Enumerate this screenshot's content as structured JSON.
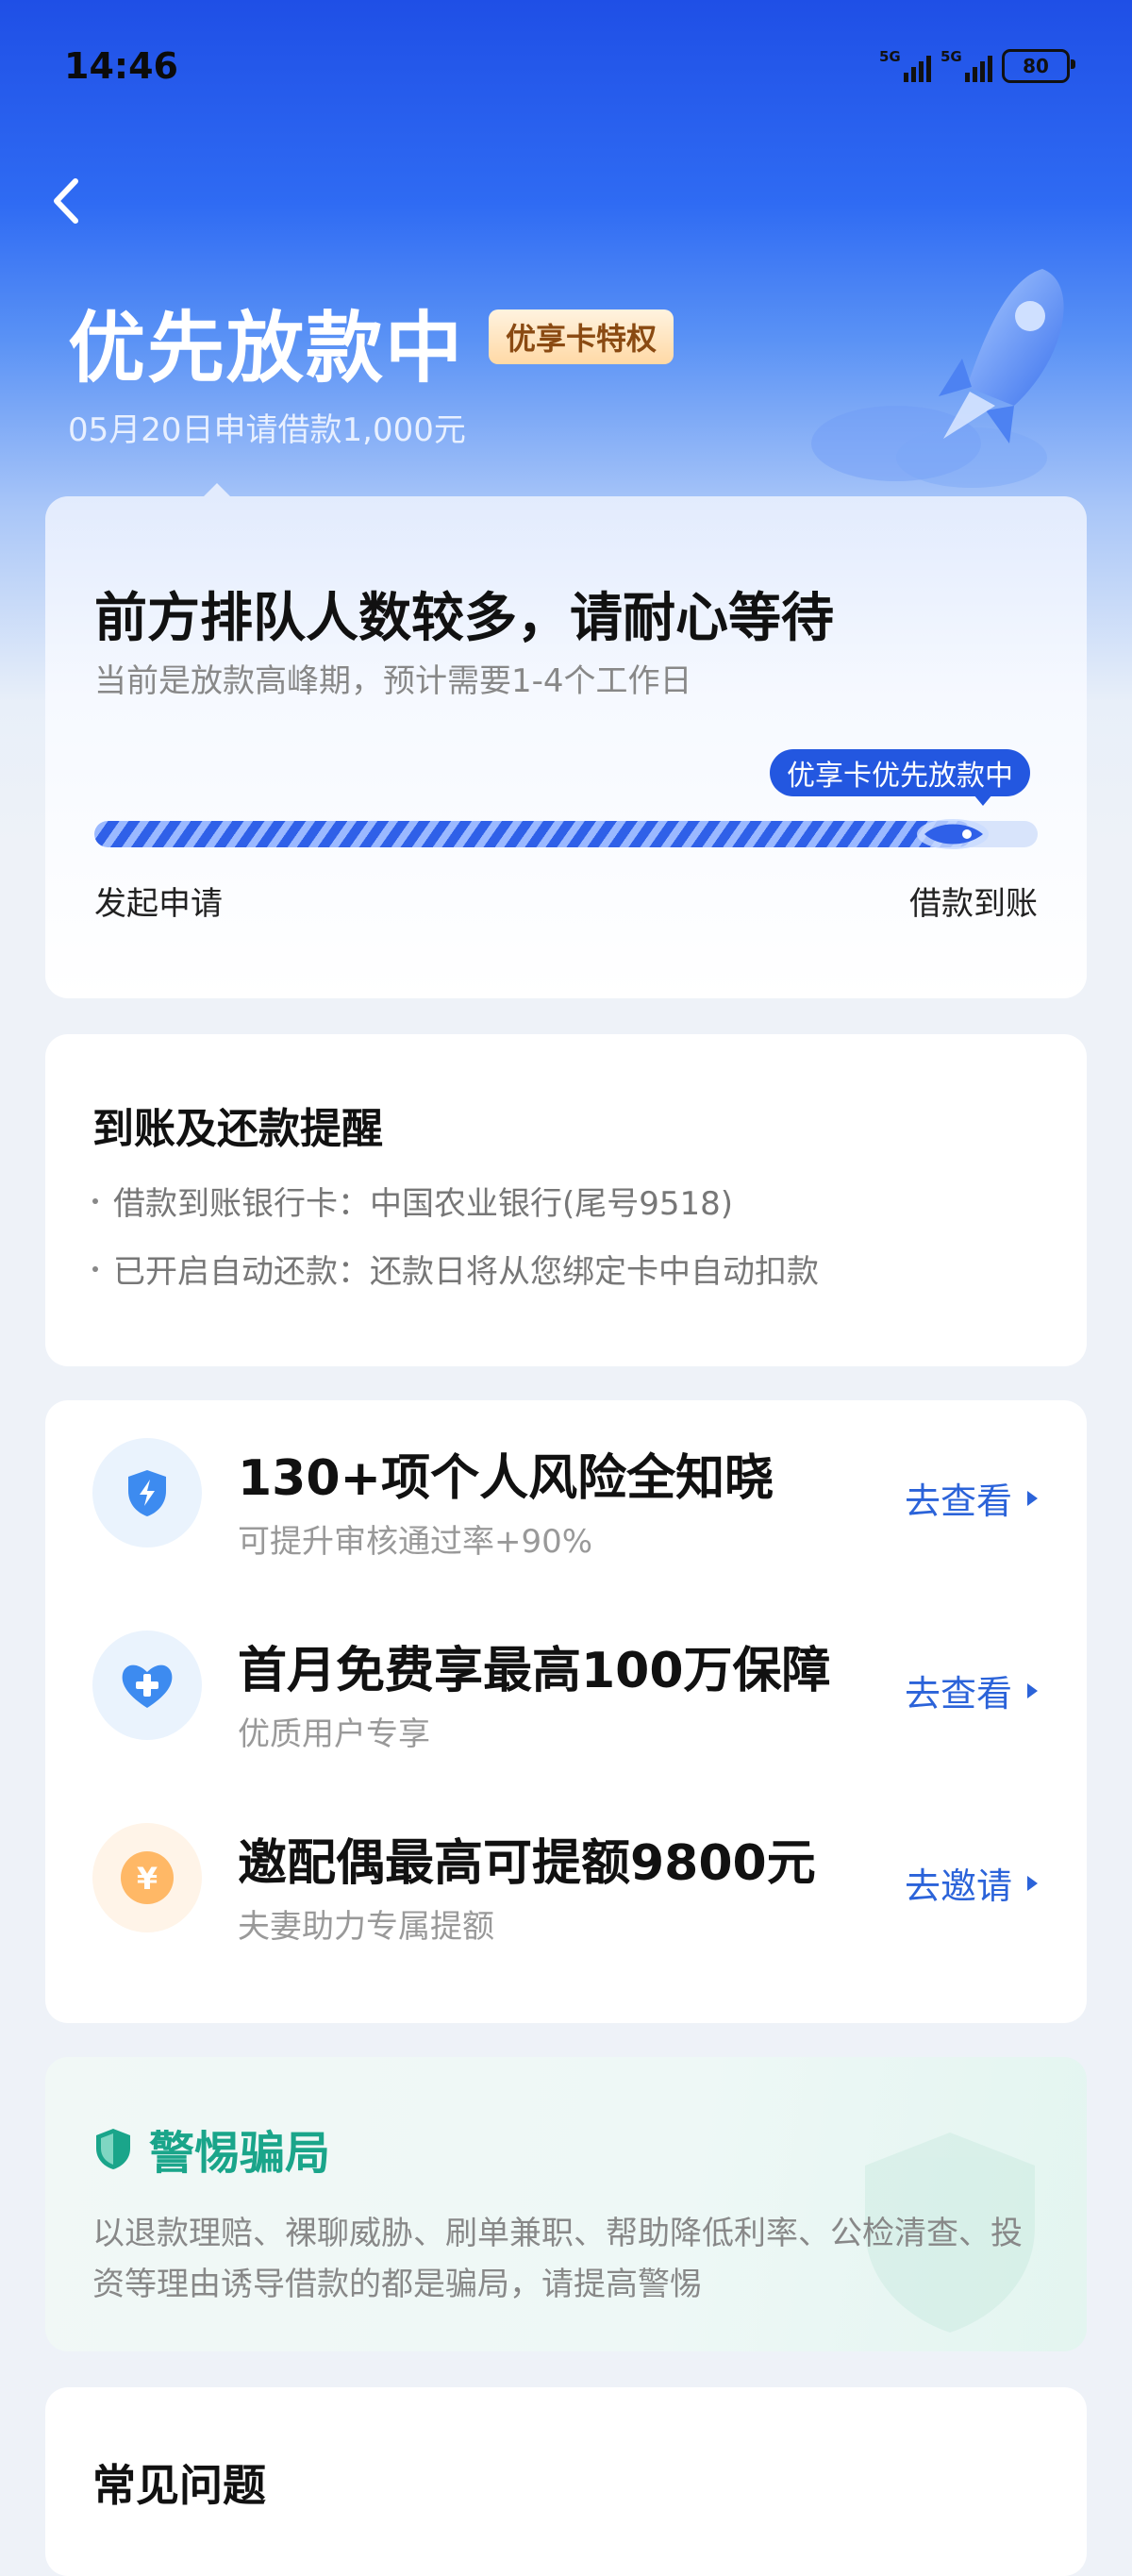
{
  "status_bar": {
    "time": "14:46",
    "sim1": "5G",
    "sim2": "5G",
    "battery": "80"
  },
  "header": {
    "title": "优先放款中",
    "badge": "优享卡特权",
    "apply_info": "05月20日申请借款1,000元"
  },
  "progress_card": {
    "title": "前方排队人数较多，请耐心等待",
    "subtitle": "当前是放款高峰期，预计需要1-4个工作日",
    "tooltip": "优享卡优先放款中",
    "progress_fraction": 0.93,
    "start_label": "发起申请",
    "end_label": "借款到账"
  },
  "reminder_card": {
    "title": "到账及还款提醒",
    "items": [
      "借款到账银行卡：中国农业银行(尾号9518)",
      "已开启自动还款：还款日将从您绑定卡中自动扣款"
    ]
  },
  "services": [
    {
      "title": "130+项个人风险全知晓",
      "subtitle": "可提升审核通过率+90%",
      "action": "去查看",
      "icon": "shield-bolt-icon"
    },
    {
      "title": "首月免费享最高100万保障",
      "subtitle": "优质用户专享",
      "action": "去查看",
      "icon": "heart-plus-icon"
    },
    {
      "title": "邀配偶最高可提额9800元",
      "subtitle": "夫妻助力专属提额",
      "action": "去邀请",
      "icon": "yen-coin-icon"
    }
  ],
  "warning_card": {
    "title": "警惕骗局",
    "body": "以退款理赔、裸聊威胁、刷单兼职、帮助降低利率、公检清查、投资等理由诱导借款的都是骗局，请提高警惕"
  },
  "faq": {
    "title": "常见问题"
  },
  "colors": {
    "primary": "#2357e0",
    "link": "#2b63d9",
    "warning_green": "#1aa58a",
    "badge_text": "#8a4a12"
  }
}
